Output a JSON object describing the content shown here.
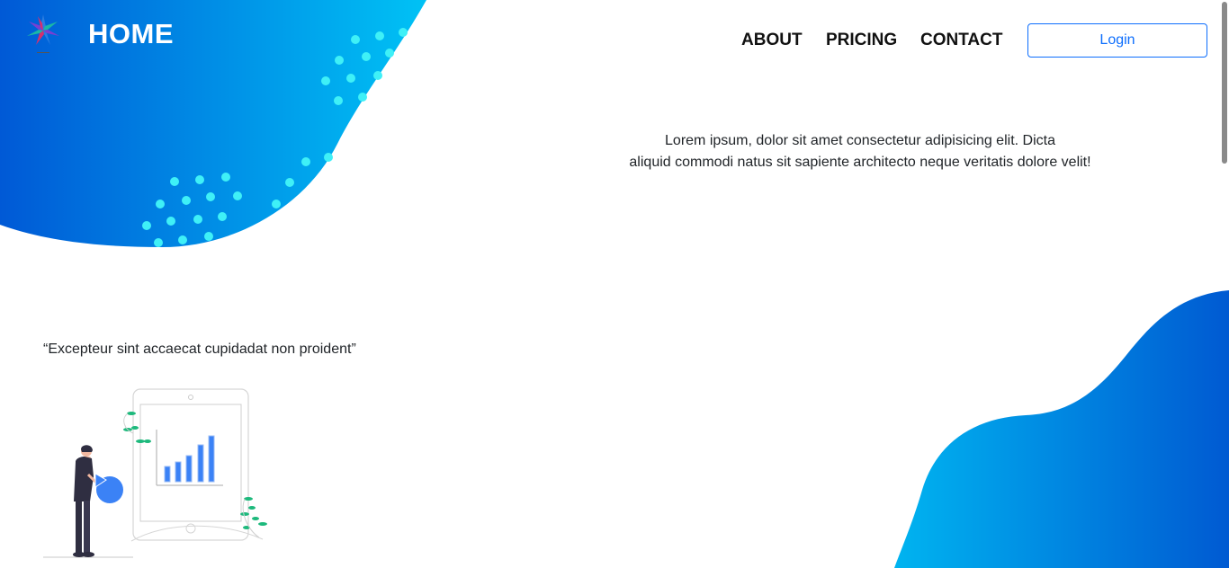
{
  "header": {
    "brand": "HOME",
    "nav": {
      "about": "ABOUT",
      "pricing": "PRICING",
      "contact": "CONTACT"
    },
    "login_label": "Login"
  },
  "hero": {
    "intro_line1": "Lorem ipsum, dolor sit amet consectetur adipisicing elit. Dicta",
    "intro_line2": "aliquid commodi natus sit sapiente architecto neque veritatis dolore velit!"
  },
  "quote": "“Excepteur sint accaecat cupidadat non proident”",
  "icons": {
    "logo": "star-logo-icon",
    "illustration": "analytics-illustration"
  },
  "colors": {
    "brand_blue": "#0059d6",
    "light_blue": "#00b4f0",
    "dot_cyan": "#3ff0f7",
    "accent_green": "#1db97c",
    "button_blue": "#0d6efd"
  }
}
